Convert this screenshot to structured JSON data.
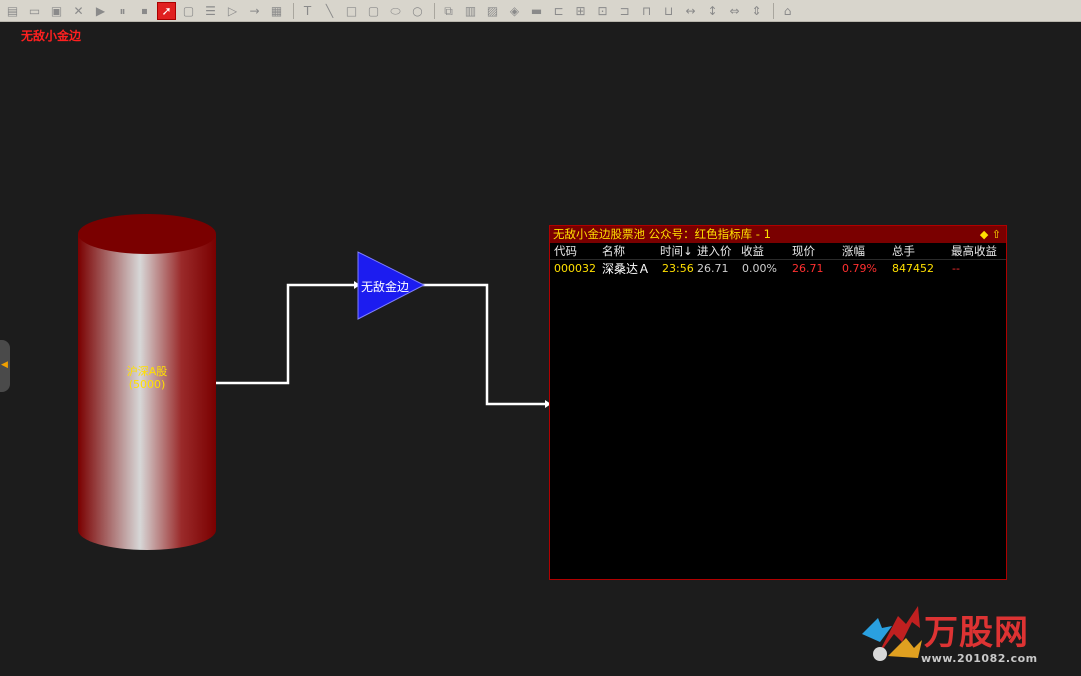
{
  "canvas": {
    "title": "无敌小金边"
  },
  "nodes": {
    "source": {
      "name": "沪深A股",
      "count": "(5000)"
    },
    "filter": {
      "name": "无敌金边"
    }
  },
  "panel": {
    "title": "无敌小金边股票池 公众号：红色指标库 - 1",
    "columns": [
      "代码",
      "名称",
      "时间↓",
      "进入价",
      "收益",
      "现价",
      "涨幅",
      "总手",
      "最高收益"
    ],
    "rows": [
      {
        "code": "000032",
        "name": "深桑达Ａ",
        "time": "23:56",
        "entry": "26.71",
        "gain": "0.00%",
        "price": "26.71",
        "change": "0.79%",
        "volume": "847452",
        "max_gain": "--"
      }
    ]
  },
  "watermark": {
    "brand": "万股网",
    "url": "www.201082.com"
  },
  "colors": {
    "accent": "#ff2020",
    "label": "#ffe000",
    "panel_head": "#7a0000"
  }
}
